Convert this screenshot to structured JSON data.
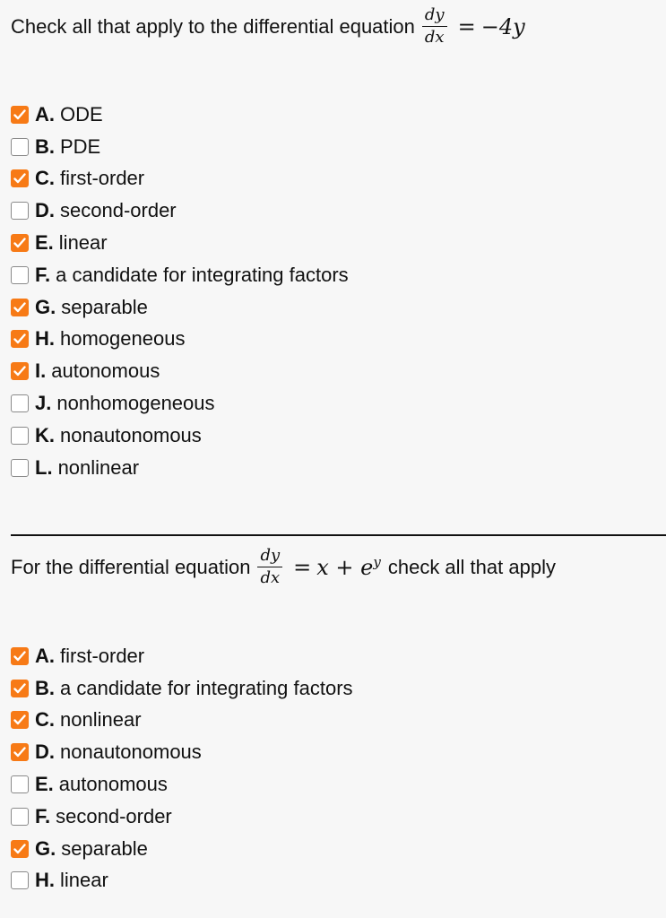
{
  "q1": {
    "prompt": "Check all that apply to the differential equation",
    "frac_num": "dy",
    "frac_den": "dx",
    "equals": "=",
    "rhs": "−4y",
    "options": [
      {
        "letter": "A.",
        "label": "ODE",
        "checked": true
      },
      {
        "letter": "B.",
        "label": "PDE",
        "checked": false
      },
      {
        "letter": "C.",
        "label": "first-order",
        "checked": true
      },
      {
        "letter": "D.",
        "label": "second-order",
        "checked": false
      },
      {
        "letter": "E.",
        "label": "linear",
        "checked": true
      },
      {
        "letter": "F.",
        "label": "a candidate for integrating factors",
        "checked": false
      },
      {
        "letter": "G.",
        "label": "separable",
        "checked": true
      },
      {
        "letter": "H.",
        "label": "homogeneous",
        "checked": true
      },
      {
        "letter": "I.",
        "label": "autonomous",
        "checked": true
      },
      {
        "letter": "J.",
        "label": "nonhomogeneous",
        "checked": false
      },
      {
        "letter": "K.",
        "label": "nonautonomous",
        "checked": false
      },
      {
        "letter": "L.",
        "label": "nonlinear",
        "checked": false
      }
    ]
  },
  "q2": {
    "prompt": "For the differential equation",
    "frac_num": "dy",
    "frac_den": "dx",
    "equals": "=",
    "rhs_x": "x + e",
    "rhs_sup": "y",
    "suffix": "check all that apply",
    "options": [
      {
        "letter": "A.",
        "label": "first-order",
        "checked": true
      },
      {
        "letter": "B.",
        "label": "a candidate for integrating factors",
        "checked": true
      },
      {
        "letter": "C.",
        "label": "nonlinear",
        "checked": true
      },
      {
        "letter": "D.",
        "label": "nonautonomous",
        "checked": true
      },
      {
        "letter": "E.",
        "label": "autonomous",
        "checked": false
      },
      {
        "letter": "F.",
        "label": "second-order",
        "checked": false
      },
      {
        "letter": "G.",
        "label": "separable",
        "checked": true
      },
      {
        "letter": "H.",
        "label": "linear",
        "checked": false
      }
    ]
  },
  "colors": {
    "checked": "#f77a16"
  }
}
